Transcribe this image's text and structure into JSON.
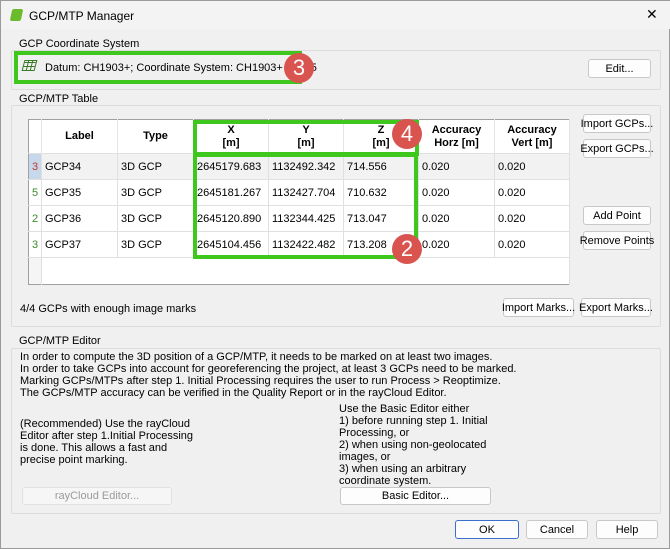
{
  "window": {
    "title": "GCP/MTP Manager",
    "close_icon": "close-icon"
  },
  "coord_system": {
    "group_label": "GCP Coordinate System",
    "text": "Datum: CH1903+; Coordinate System: CH1903+ / LV95",
    "edit_label": "Edit..."
  },
  "table_group": {
    "group_label": "GCP/MTP Table",
    "columns": [
      {
        "l1": "Label",
        "l2": ""
      },
      {
        "l1": "Type",
        "l2": ""
      },
      {
        "l1": "X",
        "l2": "[m]"
      },
      {
        "l1": "Y",
        "l2": "[m]"
      },
      {
        "l1": "Z",
        "l2": "[m]"
      },
      {
        "l1": "Accuracy",
        "l2": "Horz [m]"
      },
      {
        "l1": "Accuracy",
        "l2": "Vert [m]"
      }
    ],
    "rows": [
      {
        "marks": "3",
        "label": "GCP34",
        "type": "3D GCP",
        "x": "2645179.683",
        "y": "1132492.342",
        "z": "714.556",
        "acc_h": "0.020",
        "acc_v": "0.020"
      },
      {
        "marks": "5",
        "label": "GCP35",
        "type": "3D GCP",
        "x": "2645181.267",
        "y": "1132427.704",
        "z": "710.632",
        "acc_h": "0.020",
        "acc_v": "0.020"
      },
      {
        "marks": "2",
        "label": "GCP36",
        "type": "3D GCP",
        "x": "2645120.890",
        "y": "1132344.425",
        "z": "713.047",
        "acc_h": "0.020",
        "acc_v": "0.020"
      },
      {
        "marks": "3",
        "label": "GCP37",
        "type": "3D GCP",
        "x": "2645104.456",
        "y": "1132422.482",
        "z": "713.208",
        "acc_h": "0.020",
        "acc_v": "0.020"
      }
    ],
    "import_gcps": "Import GCPs...",
    "export_gcps": "Export GCPs...",
    "add_point": "Add Point",
    "remove_points": "Remove Points",
    "status": "4/4 GCPs with enough image marks",
    "import_marks": "Import Marks...",
    "export_marks": "Export Marks..."
  },
  "editor": {
    "group_label": "GCP/MTP Editor",
    "info": "In order to compute the 3D position of a GCP/MTP, it needs to be marked on at least two images.\nIn order to take GCPs into account for georeferencing the project, at least 3 GCPs need to be marked.\nMarking GCPs/MTPs after step 1. Initial Processing requires the user to run Process > Reoptimize.\nThe GCPs/MTP accuracy can be verified in the Quality Report or in the rayCloud Editor.",
    "raycloud_text": "(Recommended) Use the rayCloud\nEditor after step 1.Initial Processing\nis done. This allows a fast and\nprecise point marking.",
    "basic_text": "Use the Basic Editor either\n1) before running step 1. Initial\nProcessing, or\n2) when using non-geolocated\nimages, or\n3) when using an arbitrary\ncoordinate system.",
    "raycloud_button": "rayCloud Editor...",
    "basic_button": "Basic Editor..."
  },
  "footer": {
    "ok": "OK",
    "cancel": "Cancel",
    "help": "Help"
  },
  "annotations": {
    "badge_3": "3",
    "badge_4": "4",
    "badge_2": "2",
    "highlight_color": "#3ec81e",
    "badge_color": "#d9534f"
  }
}
